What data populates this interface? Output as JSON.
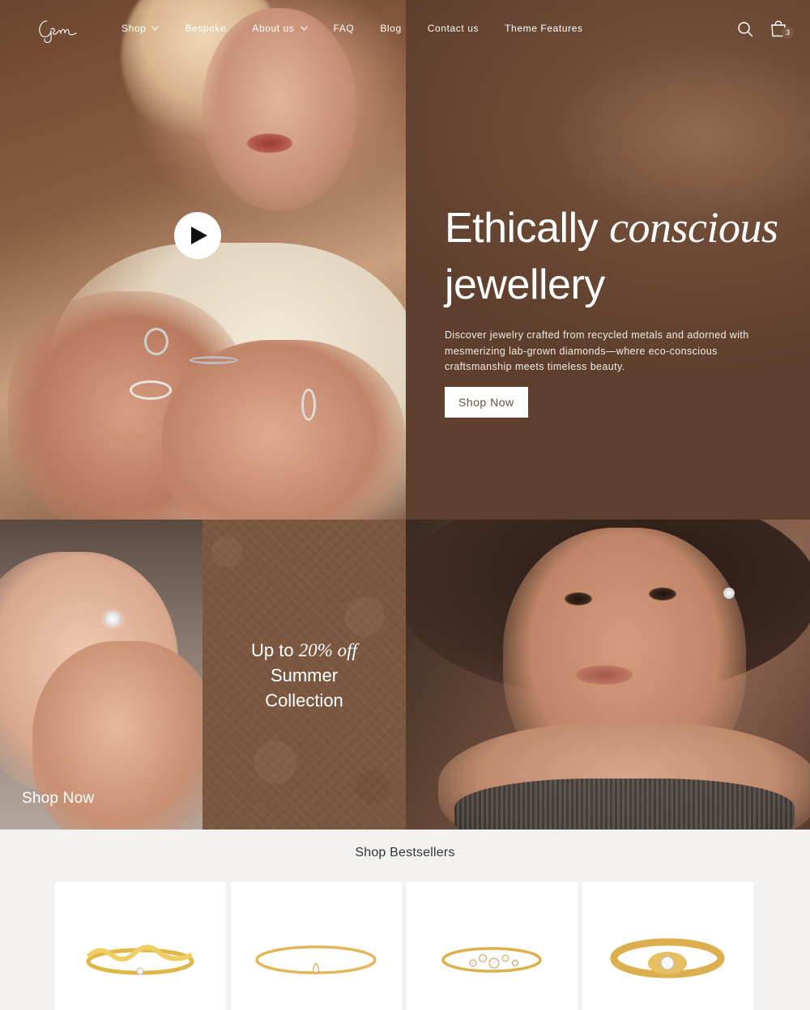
{
  "header": {
    "logo_text": "Gem",
    "nav": [
      {
        "label": "Shop",
        "has_dropdown": true
      },
      {
        "label": "Bespoke",
        "has_dropdown": false
      },
      {
        "label": "About us",
        "has_dropdown": true
      },
      {
        "label": "FAQ",
        "has_dropdown": false
      },
      {
        "label": "Blog",
        "has_dropdown": false
      },
      {
        "label": "Contact us",
        "has_dropdown": false
      },
      {
        "label": "Theme Features",
        "has_dropdown": false
      }
    ],
    "icons": {
      "search": "search-icon",
      "cart": "bag-icon"
    },
    "cart_count": "3"
  },
  "hero": {
    "title_part1": "Ethically ",
    "title_emphasis": "conscious",
    "title_part2": "jewellery",
    "description": "Discover jewelry crafted from recycled metals and adorned with mesmerizing lab-grown diamonds—where eco-conscious craftsmanship meets timeless beauty.",
    "cta_label": "Shop Now",
    "video_icon": "play-icon"
  },
  "promo": {
    "left_cta": "Shop Now",
    "offer_prefix": "Up to ",
    "offer_emphasis": "20% off",
    "offer_line2": "Summer",
    "offer_line3": "Collection"
  },
  "bestsellers": {
    "title": "Shop Bestsellers",
    "products": [
      {
        "name": "wavy-gold-ring"
      },
      {
        "name": "pear-diamond-band"
      },
      {
        "name": "cluster-diamond-ring"
      },
      {
        "name": "signet-diamond-ring"
      }
    ]
  },
  "colors": {
    "hero_panel": "#6d4b36",
    "offer_tile": "#7b5740",
    "button_text": "#6b4e3c",
    "page_bg": "#f3f2f1",
    "gold": "#d9ad4a"
  }
}
